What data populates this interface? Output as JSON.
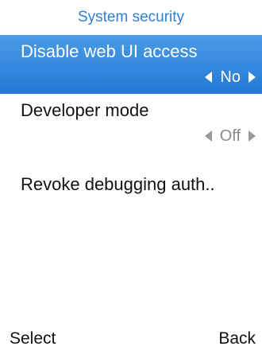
{
  "header": {
    "title": "System security"
  },
  "menu": {
    "items": [
      {
        "label": "Disable web UI access",
        "value": "No",
        "selected": true
      },
      {
        "label": "Developer mode",
        "value": "Off",
        "selected": false
      },
      {
        "label": "Revoke debugging auth..",
        "selected": false
      }
    ]
  },
  "softkeys": {
    "left": "Select",
    "right": "Back"
  },
  "colors": {
    "accent": "#2f7fd6",
    "selection_top": "#4a9be8",
    "selection_bottom": "#2379d4"
  }
}
